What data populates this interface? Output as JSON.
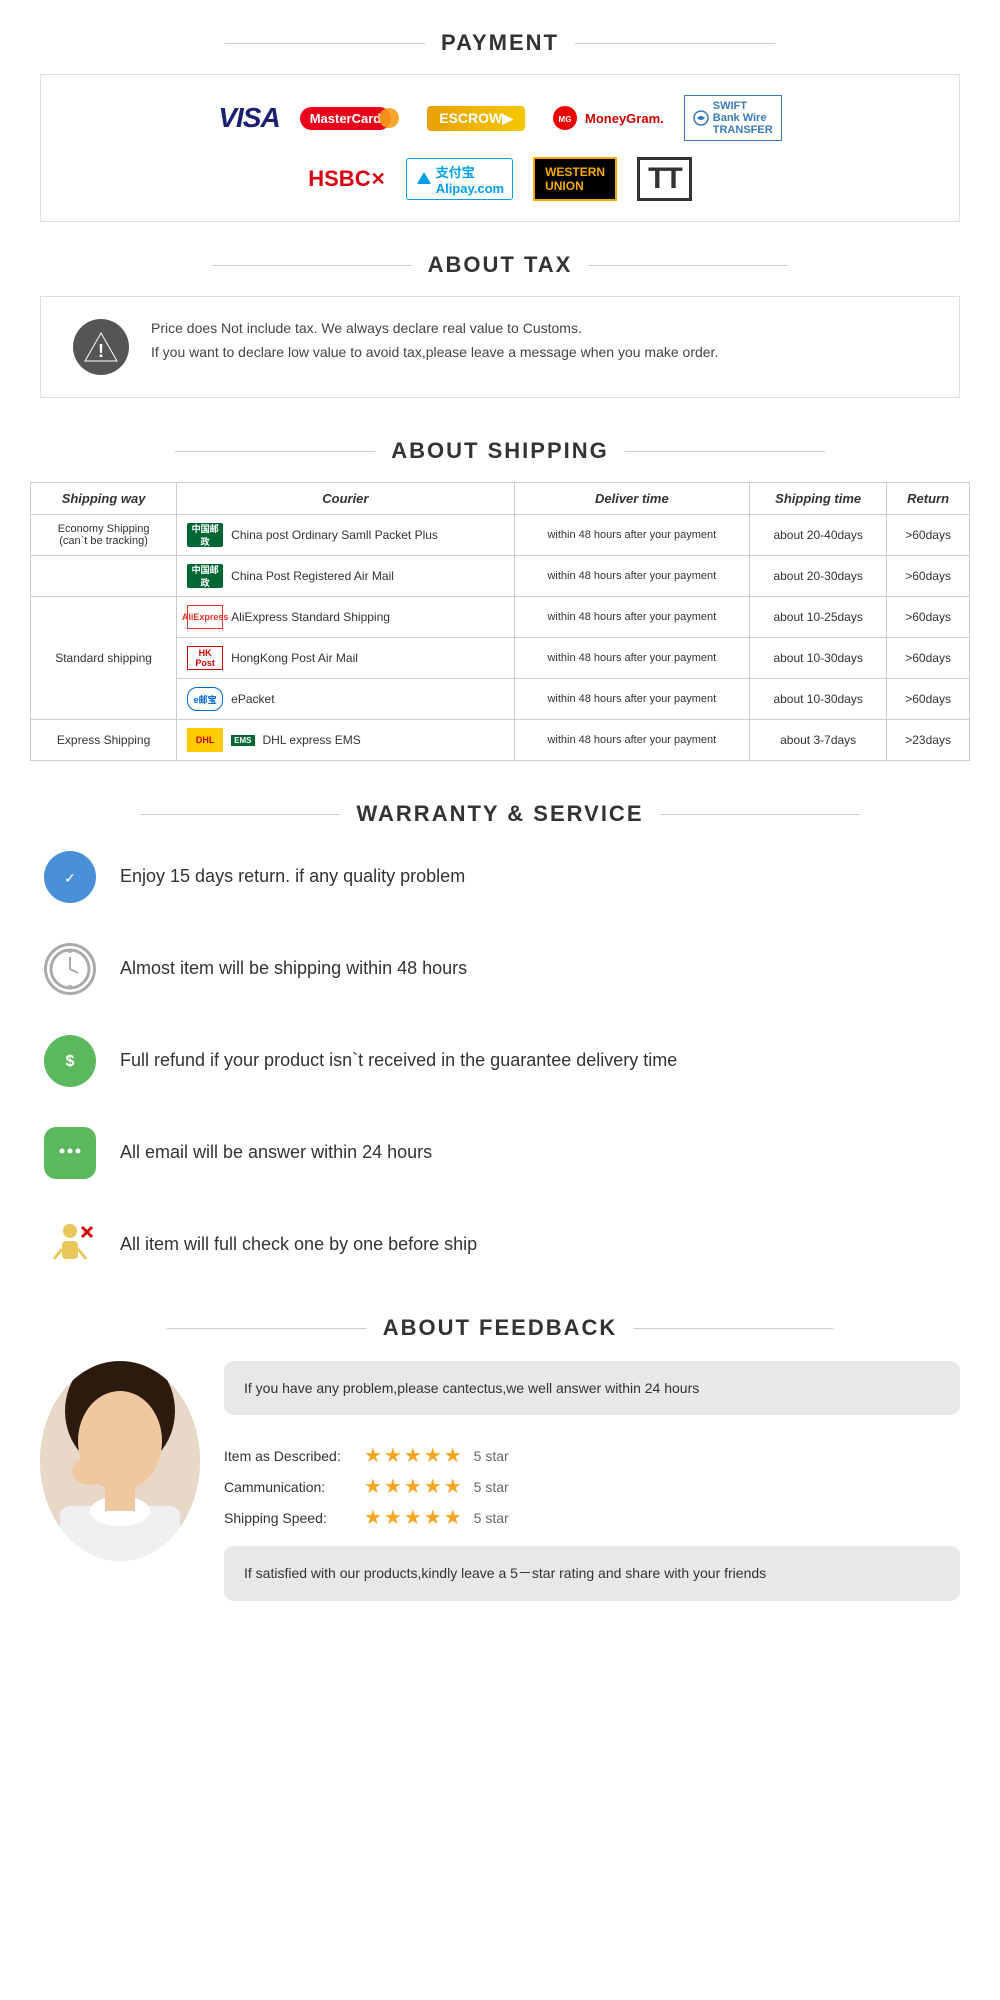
{
  "payment": {
    "title": "PAYMENT",
    "row1": [
      "VISA",
      "MasterCard",
      "ESCROW",
      "MoneyGram.",
      "Bank Wire Transfer"
    ],
    "row2": [
      "HSBC",
      "Alipay.com",
      "WESTERN UNION",
      "TT"
    ]
  },
  "tax": {
    "title": "ABOUT TAX",
    "text1": "Price does Not include tax. We always declare real value to Customs.",
    "text2": "If you want to declare low value to avoid tax,please leave a message when you make order."
  },
  "shipping": {
    "title": "ABOUT SHIPPING",
    "headers": [
      "Shipping way",
      "Courier",
      "Deliver time",
      "Shipping time",
      "Return"
    ],
    "rows": [
      {
        "way": "Economy Shipping\n(can`t be tracking)",
        "courier": "China post Ordinary Samll Packet Plus",
        "courier_type": "china-post",
        "deliver": "within 48 hours after your payment",
        "shipping_time": "about 20-40days",
        "return": ">60days"
      },
      {
        "way": "",
        "courier": "China Post Registered Air Mail",
        "courier_type": "china-post",
        "deliver": "within 48 hours after your payment",
        "shipping_time": "about 20-30days",
        "return": ">60days"
      },
      {
        "way": "Standard shipping",
        "courier": "AliExpress Standard Shipping",
        "courier_type": "aliexpress",
        "deliver": "within 48 hours after your payment",
        "shipping_time": "about 10-25days",
        "return": ">60days"
      },
      {
        "way": "",
        "courier": "HongKong Post Air Mail",
        "courier_type": "hkpost",
        "deliver": "within 48 hours after your payment",
        "shipping_time": "about 10-30days",
        "return": ">60days"
      },
      {
        "way": "",
        "courier": "ePacket",
        "courier_type": "epacket",
        "deliver": "within 48 hours after your payment",
        "shipping_time": "about 10-30days",
        "return": ">60days"
      },
      {
        "way": "Express Shipping",
        "courier": "DHL express  EMS",
        "courier_type": "dhl",
        "deliver": "within 48 hours after your payment",
        "shipping_time": "about 3-7days",
        "return": ">23days"
      }
    ]
  },
  "warranty": {
    "title": "WARRANTY & SERVICE",
    "items": [
      {
        "icon": "shield",
        "text": "Enjoy 15 days return. if any quality problem"
      },
      {
        "icon": "clock",
        "text": "Almost item will be shipping within 48 hours"
      },
      {
        "icon": "money",
        "text": "Full refund if your product isn`t received in the guarantee delivery time"
      },
      {
        "icon": "chat",
        "text": "All email will be answer within 24 hours"
      },
      {
        "icon": "check",
        "text": "All item will full check one by one before ship"
      }
    ]
  },
  "feedback": {
    "title": "ABOUT FEEDBACK",
    "bubble_top": "If you have any problem,please cantectus,we well answer within 24 hours",
    "ratings": [
      {
        "label": "Item as Described:",
        "stars": 5,
        "text": "5 star"
      },
      {
        "label": "Cammunication:",
        "stars": 5,
        "text": "5 star"
      },
      {
        "label": "Shipping Speed:",
        "stars": 5,
        "text": "5 star"
      }
    ],
    "bubble_bottom": "If satisfied with our products,kindly leave a 5－star rating and share with your friends"
  }
}
